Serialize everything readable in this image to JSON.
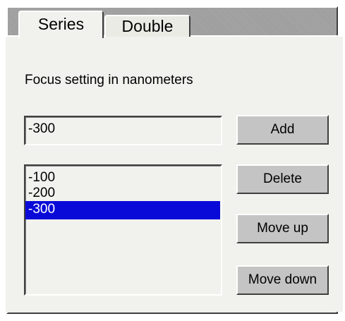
{
  "tabs": [
    {
      "label": "Series",
      "active": true
    },
    {
      "label": "Double",
      "active": false
    }
  ],
  "panel": {
    "label": "Focus setting in nanometers",
    "input_value": "-300",
    "list_items": [
      "-100",
      "-200",
      "-300"
    ],
    "selected_item": "-300"
  },
  "buttons": {
    "add": "Add",
    "delete": "Delete",
    "move_up": "Move up",
    "move_down": "Move down"
  },
  "colors": {
    "selection": "#0a0ad8",
    "panel_bg": "#f1f2ed",
    "button_bg": "#c4c4c4"
  }
}
